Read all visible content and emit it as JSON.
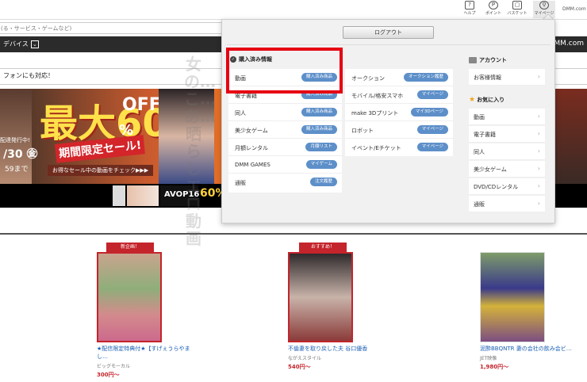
{
  "topbar": {
    "items": [
      {
        "label": "ヘルプ",
        "glyph": "?"
      },
      {
        "label": "ポイント",
        "glyph": "P"
      },
      {
        "label": "バスケット",
        "glyph": "▢"
      },
      {
        "label": "マイページ",
        "glyph": "⚲"
      }
    ],
    "domain": "DMM.com"
  },
  "search": {
    "placeholder": "(る・サービス・ゲームなど)"
  },
  "nav": {
    "devices_label": "デバイス",
    "right_text": "DMM.com"
  },
  "phone_text": "フォンにも対応！",
  "watermark_text": "女の…こ…あ…晒らしエロ動画",
  "banner": {
    "big": "最大60",
    "percent": "%",
    "off": "OFF",
    "sale": "期間限定セール!",
    "sub": "お得なセール中の動画をチェック▶▶▶",
    "left_date": "配達発行中!",
    "left_big": "/30 ㊎",
    "left_time": "59まで",
    "avop": "AVOP16",
    "avop_pct": "60%"
  },
  "panel": {
    "logout_label": "ログアウト",
    "purchases_title": "購入済み情報",
    "purchases": [
      {
        "label": "動画",
        "button": "購入済み商品"
      },
      {
        "label": "電子書籍",
        "button": "購入済み商品"
      },
      {
        "label": "同人",
        "button": "購入済み商品"
      },
      {
        "label": "美少女ゲーム",
        "button": "購入済み商品"
      },
      {
        "label": "月額レンタル",
        "button": "月額リスト"
      },
      {
        "label": "DMM GAMES",
        "button": "マイゲーム"
      },
      {
        "label": "通販",
        "button": "注文履歴"
      }
    ],
    "others": [
      {
        "label": "オークション",
        "button": "オークション履歴"
      },
      {
        "label": "モバイル/格安スマホ",
        "button": "マイページ"
      },
      {
        "label": "make 3Dプリント",
        "button": "マイ3Dページ"
      },
      {
        "label": "ロボット",
        "button": "マイページ"
      },
      {
        "label": "イベント/Eチケット",
        "button": "マイページ"
      }
    ],
    "account_title": "アカウント",
    "account_items": [
      {
        "label": "お客様情報"
      }
    ],
    "favorites_title": "お気に入り",
    "favorites": [
      {
        "label": "動画"
      },
      {
        "label": "電子書籍"
      },
      {
        "label": "同人"
      },
      {
        "label": "美少女ゲーム"
      },
      {
        "label": "DVD/CDレンタル"
      },
      {
        "label": "通販"
      }
    ]
  },
  "products": [
    {
      "badge": "新企画！",
      "title": "★配信限定特典付★【すげぇうらやまし…",
      "maker": "ビッグモーカル",
      "price": "300円〜"
    },
    {
      "badge": "おすすめ！",
      "title": "不倫妻を取り戻した夫 谷口優香",
      "maker": "ながえスタイル",
      "price": "540円〜"
    },
    {
      "badge": "",
      "title": "泥酔BBQNTR 妻の会社の飲み会ビ…",
      "maker": "JET映像",
      "price": "1,980円〜"
    }
  ],
  "colors": {
    "accent_blue": "#5d8fc9",
    "highlight_red": "#e60012",
    "badge_red": "#c4242b",
    "nav_dark": "#2b2b2b"
  }
}
